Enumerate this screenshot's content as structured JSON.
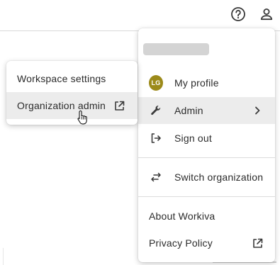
{
  "topbar": {
    "help_icon": "help-circle-icon",
    "user_icon": "user-icon"
  },
  "account_menu": {
    "user_name_placeholder": "loading",
    "avatar_initials": "LG",
    "avatar_color": "#9c8a1a",
    "items": [
      {
        "label": "My profile",
        "icon": "avatar"
      },
      {
        "label": "Admin",
        "icon": "wrench-icon",
        "trailing": "chevron-right-icon",
        "active": true
      },
      {
        "label": "Sign out",
        "icon": "sign-out-icon"
      },
      {
        "label": "Switch organization",
        "icon": "swap-arrows-icon"
      },
      {
        "label": "About Workiva"
      },
      {
        "label": "Privacy Policy",
        "trailing": "external-link-icon"
      }
    ]
  },
  "admin_submenu": {
    "items": [
      {
        "label": "Workspace settings"
      },
      {
        "label": "Organization admin",
        "trailing": "external-link-icon",
        "hovered": true
      }
    ]
  },
  "colors": {
    "hover_background": "#ececec",
    "divider": "#dcdcdc",
    "text": "#2b2b2b",
    "icon": "#3a3a3a"
  }
}
